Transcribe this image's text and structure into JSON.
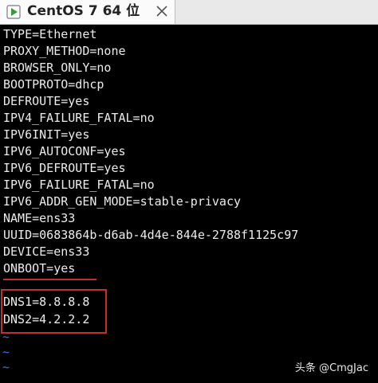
{
  "tab": {
    "title": "CentOS 7 64 位",
    "icon": "vm-play-icon",
    "close_icon": "close-icon"
  },
  "terminal": {
    "lines": [
      "TYPE=Ethernet",
      "PROXY_METHOD=none",
      "BROWSER_ONLY=no",
      "BOOTPROTO=dhcp",
      "DEFROUTE=yes",
      "IPV4_FAILURE_FATAL=no",
      "IPV6INIT=yes",
      "IPV6_AUTOCONF=yes",
      "IPV6_DEFROUTE=yes",
      "IPV6_FAILURE_FATAL=no",
      "IPV6_ADDR_GEN_MODE=stable-privacy",
      "NAME=ens33",
      "UUID=0683864b-d6ab-4d4e-844e-2788f1125c97",
      "DEVICE=ens33",
      "ONBOOT=yes"
    ],
    "dns_lines": [
      "DNS1=8.8.8.8",
      "DNS2=4.2.2.2"
    ],
    "tilde": "~",
    "highlight_color": "#c0312b"
  },
  "watermark": "头条 @CmgJac"
}
